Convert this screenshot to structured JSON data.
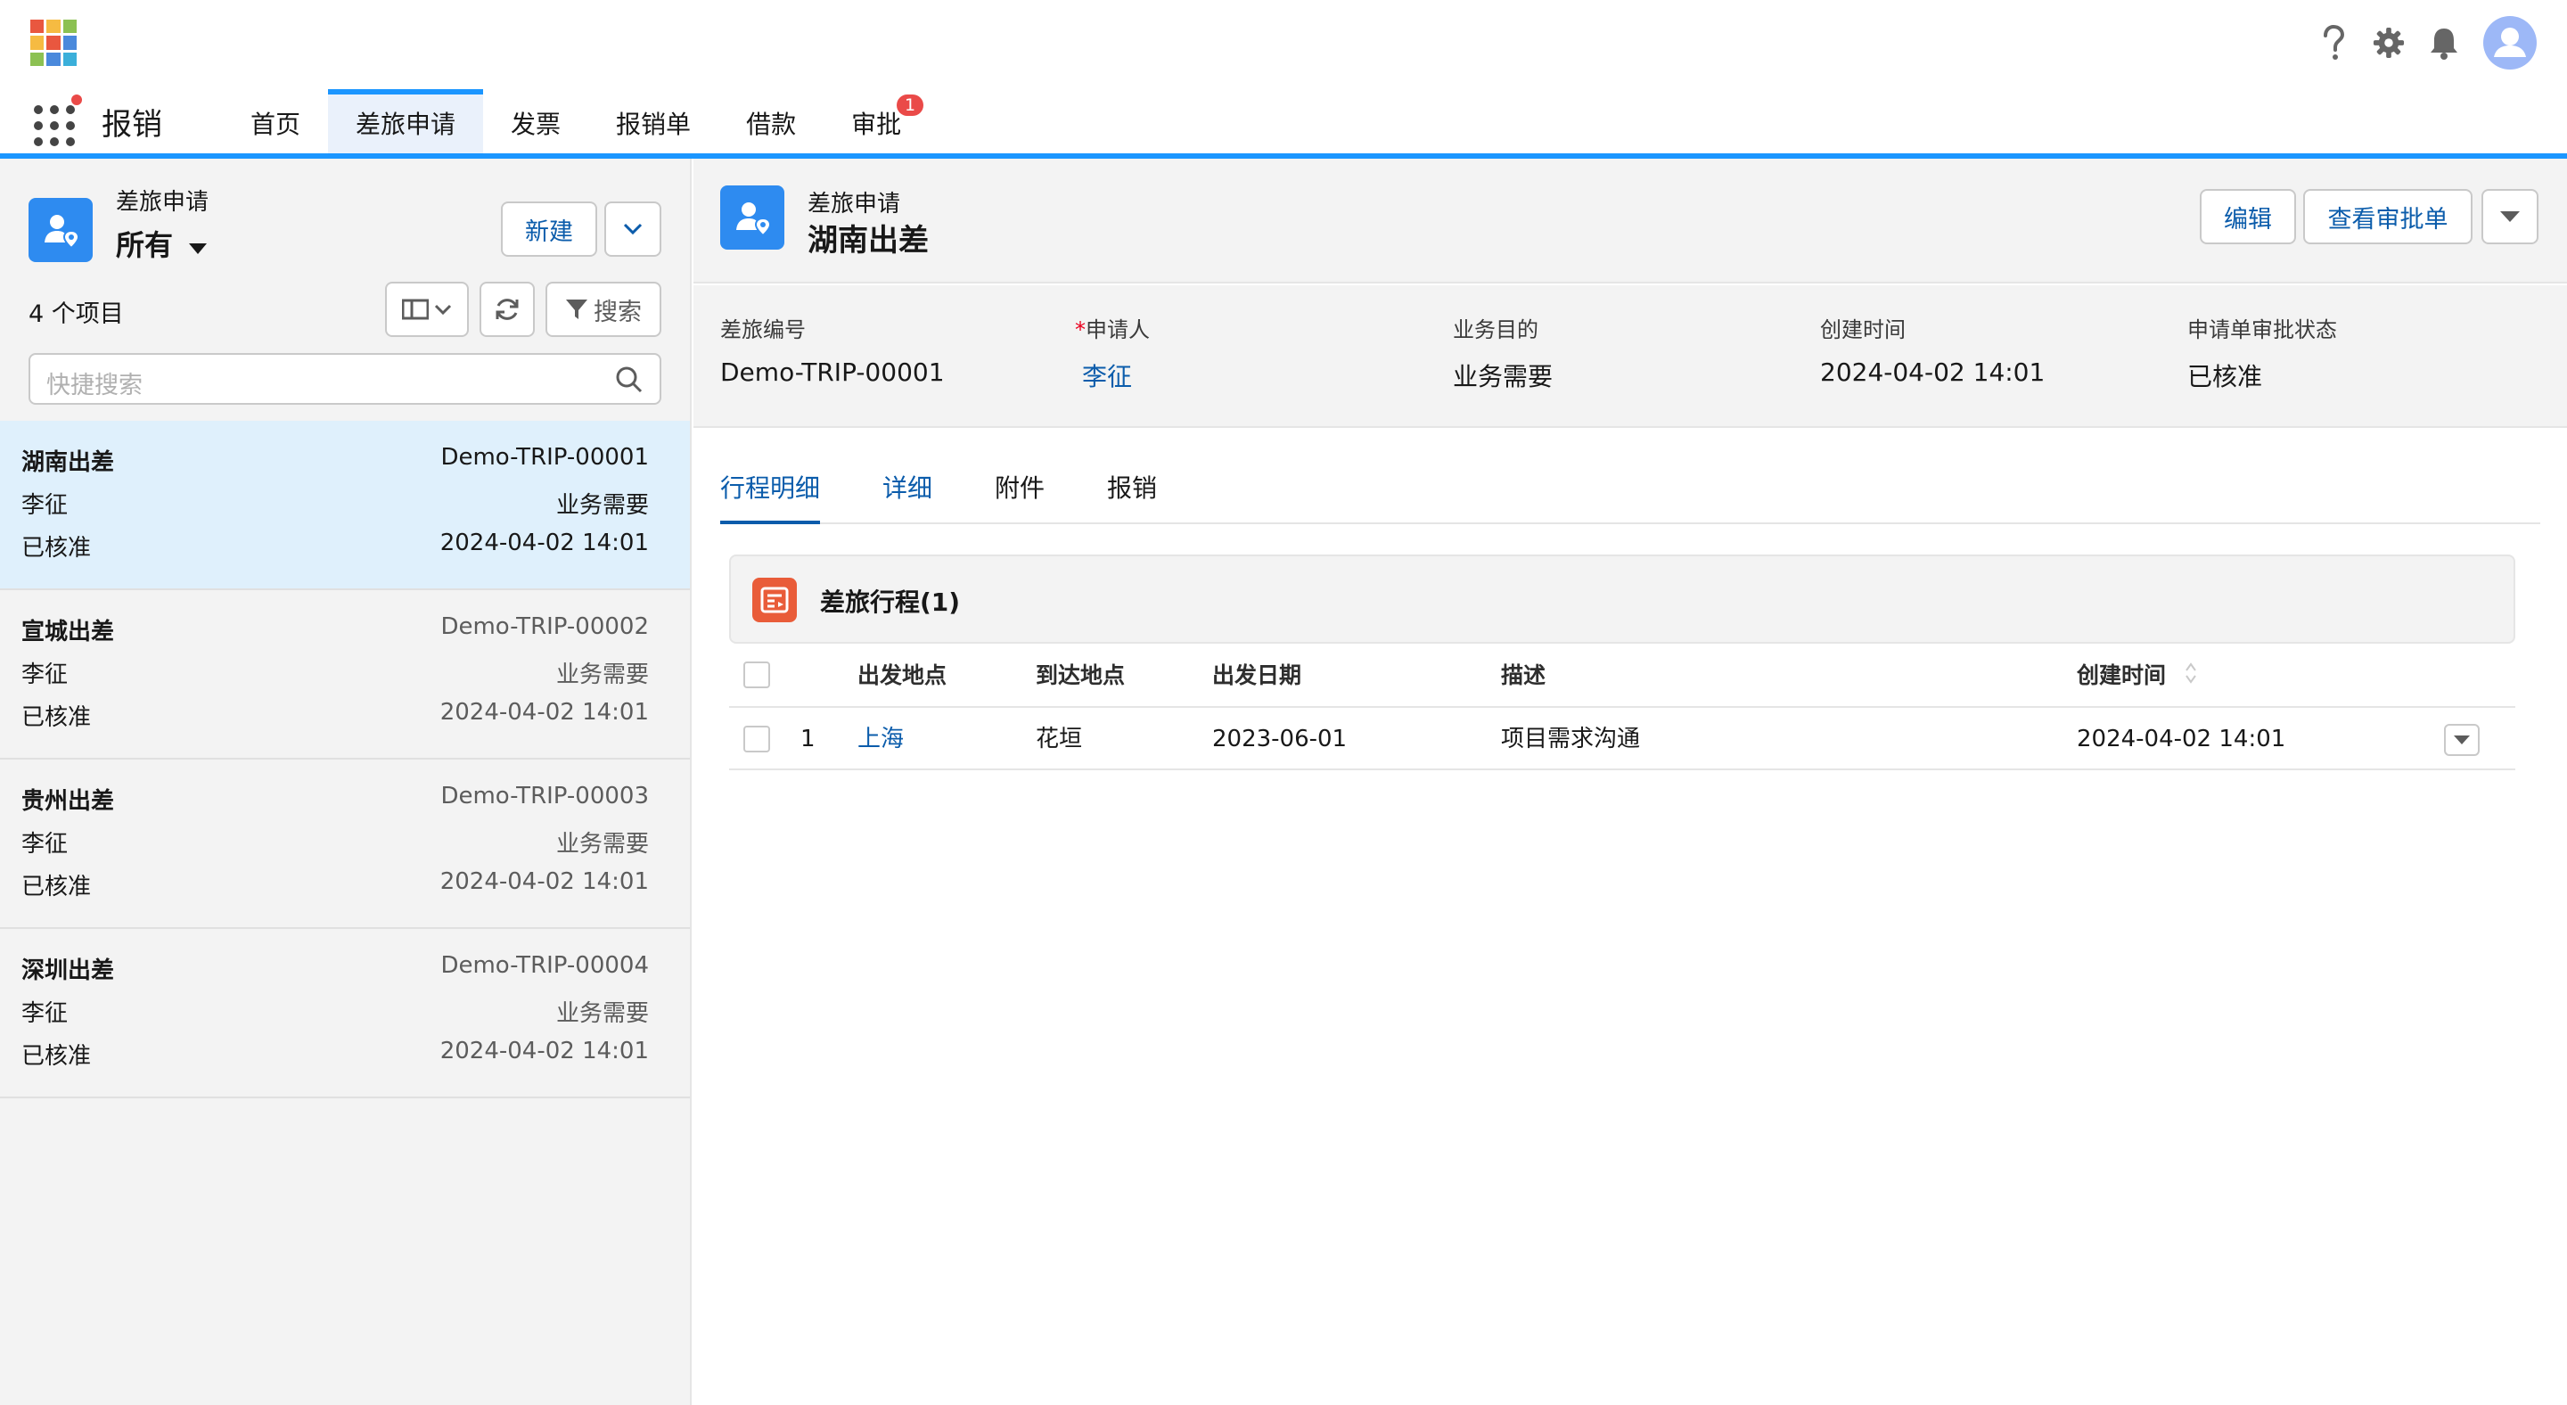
{
  "header": {
    "logo_colors": [
      "#e9573f",
      "#f6bb42",
      "#8cc152",
      "#37bc9b",
      "#4a89dc",
      "#967adc",
      "#3bafda",
      "#f6bb42",
      "#e9573f"
    ],
    "icons": [
      "help-icon",
      "gear-icon",
      "bell-icon",
      "user-avatar-icon"
    ]
  },
  "appnav": {
    "app_name": "报销",
    "tabs": [
      {
        "label": "首页"
      },
      {
        "label": "差旅申请"
      },
      {
        "label": "发票"
      },
      {
        "label": "报销单"
      },
      {
        "label": "借款"
      },
      {
        "label": "审批",
        "badge": "1"
      }
    ],
    "active_tab": "差旅申请"
  },
  "list_panel": {
    "subtitle": "差旅申请",
    "view_name": "所有",
    "new_button": "新建",
    "item_count": "4 个项目",
    "search_button": "搜索",
    "quick_search_placeholder": "快捷搜索",
    "items": [
      {
        "title": "湖南出差",
        "number": "Demo-TRIP-00001",
        "applicant": "李征",
        "purpose": "业务需要",
        "status": "已核准",
        "created": "2024-04-02 14:01"
      },
      {
        "title": "宣城出差",
        "number": "Demo-TRIP-00002",
        "applicant": "李征",
        "purpose": "业务需要",
        "status": "已核准",
        "created": "2024-04-02 14:01"
      },
      {
        "title": "贵州出差",
        "number": "Demo-TRIP-00003",
        "applicant": "李征",
        "purpose": "业务需要",
        "status": "已核准",
        "created": "2024-04-02 14:01"
      },
      {
        "title": "深圳出差",
        "number": "Demo-TRIP-00004",
        "applicant": "李征",
        "purpose": "业务需要",
        "status": "已核准",
        "created": "2024-04-02 14:01"
      }
    ]
  },
  "record": {
    "subtitle": "差旅申请",
    "title": "湖南出差",
    "edit_button": "编辑",
    "view_approval_button": "查看审批单",
    "fields": [
      {
        "label": "差旅编号",
        "value": "Demo-TRIP-00001"
      },
      {
        "label": "申请人",
        "required_mark": "*",
        "value": "李征"
      },
      {
        "label": "业务目的",
        "value": "业务需要"
      },
      {
        "label": "创建时间",
        "value": "2024-04-02 14:01"
      },
      {
        "label": "申请单审批状态",
        "value": "已核准"
      }
    ],
    "tabs": [
      "行程明细",
      "详细",
      "附件",
      "报销"
    ],
    "active_tab": "行程明细",
    "related": {
      "title": "差旅行程(1)",
      "columns": [
        "出发地点",
        "到达地点",
        "出发日期",
        "描述",
        "创建时间"
      ],
      "rows": [
        {
          "index": "1",
          "from": "上海",
          "to": "花垣",
          "date": "2023-06-01",
          "desc": "项目需求沟通",
          "created": "2024-04-02 14:01"
        }
      ]
    }
  }
}
